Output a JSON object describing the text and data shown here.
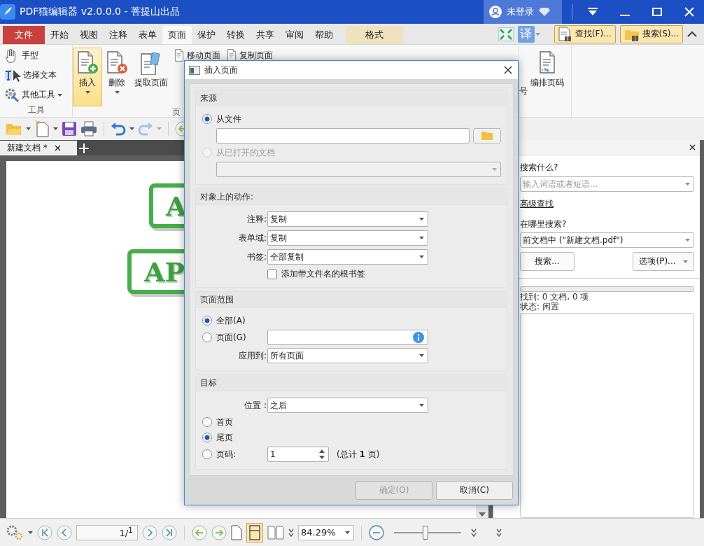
{
  "window": {
    "title": "PDF猫编辑器 v2.0.0.0 - 菩提山出品",
    "user": "未登录"
  },
  "ribbon_tabs": [
    {
      "label": "文件",
      "kind": "file",
      "selected": false
    },
    {
      "label": "开始",
      "kind": "normal",
      "selected": false
    },
    {
      "label": "视图",
      "kind": "normal",
      "selected": false
    },
    {
      "label": "注释",
      "kind": "normal",
      "selected": false
    },
    {
      "label": "表单",
      "kind": "normal",
      "selected": false
    },
    {
      "label": "页面",
      "kind": "normal",
      "selected": true
    },
    {
      "label": "保护",
      "kind": "normal",
      "selected": false
    },
    {
      "label": "转换",
      "kind": "normal",
      "selected": false
    },
    {
      "label": "共享",
      "kind": "normal",
      "selected": false
    },
    {
      "label": "审阅",
      "kind": "normal",
      "selected": false
    },
    {
      "label": "帮助",
      "kind": "normal",
      "selected": false
    },
    {
      "label": "格式",
      "kind": "context",
      "selected": false
    }
  ],
  "ribbon_tools": {
    "translate": "译",
    "find": "查找(F)...",
    "search": "搜索(S)..."
  },
  "ribbon": {
    "tool_items": [
      {
        "label": "手型",
        "kind": "hand",
        "dropdown": false
      },
      {
        "label": "选择文本",
        "kind": "select",
        "dropdown": false
      },
      {
        "label": "其他工具",
        "kind": "other",
        "dropdown": true
      }
    ],
    "tool_group": "工具",
    "page_buttons": [
      {
        "label": "插入",
        "kind": "insert",
        "active": true,
        "dropdown": true
      },
      {
        "label": "删除",
        "kind": "delete",
        "active": false,
        "dropdown": true
      },
      {
        "label": "提取页面",
        "kind": "extract",
        "active": false,
        "dropdown": false
      }
    ],
    "page_small": [
      "移动页面",
      "复制页面"
    ],
    "page_group": "页",
    "tail_label": "号",
    "number_button": "编排页码"
  },
  "document": {
    "tab": "新建文档 *",
    "stamps": [
      "A",
      "AP"
    ]
  },
  "search_panel": {
    "what_label": "搜索什么?",
    "query_placeholder": "输入词语或者短语...",
    "advanced_link": "高级查找",
    "where_label": "在哪里搜索?",
    "scope": "前文档中 (\"新建文档.pdf\")",
    "search_button": "搜索...",
    "options_button": "选项(P)...",
    "progress": {
      "level": 0
    },
    "found": "找到: 0 文档, 0 项",
    "status": "状态: 闲置"
  },
  "status_bar": {
    "page": "1/$^{1}$",
    "zoom": "84.29%",
    "zoom_slider": {
      "level": 0.47
    }
  },
  "dialog": {
    "title": "插入页面",
    "source": {
      "heading": "来源",
      "options": [
        {
          "label": "从文件",
          "selected": true,
          "disabled": false
        },
        {
          "label": "从已打开的文档",
          "selected": false,
          "disabled": true
        }
      ]
    },
    "actions": {
      "heading": "对象上的动作:",
      "fields": [
        {
          "label": "注释:",
          "value": "复制"
        },
        {
          "label": "表单域:",
          "value": "复制"
        },
        {
          "label": "书签:",
          "value": "全部复制"
        }
      ],
      "checkbox": {
        "label": "添加带文件名的根书签",
        "checked": false
      }
    },
    "range": {
      "heading": "页面范围",
      "options": [
        {
          "label": "全部(A)",
          "selected": true
        },
        {
          "label": "页面(G)",
          "selected": false
        }
      ],
      "apply_label": "应用到:",
      "apply_value": "所有页面"
    },
    "target": {
      "heading": "目标",
      "position_label": "位置 :",
      "position_value": "之后",
      "options": [
        {
          "label": "首页",
          "selected": false
        },
        {
          "label": "尾页",
          "selected": true
        },
        {
          "label": "页码:",
          "selected": false
        }
      ],
      "page_number": "1",
      "total": "(总计 **1** 页)"
    },
    "buttons": [
      {
        "label": "确定(O)",
        "disabled": true
      },
      {
        "label": "取消(C)",
        "disabled": false
      }
    ]
  }
}
